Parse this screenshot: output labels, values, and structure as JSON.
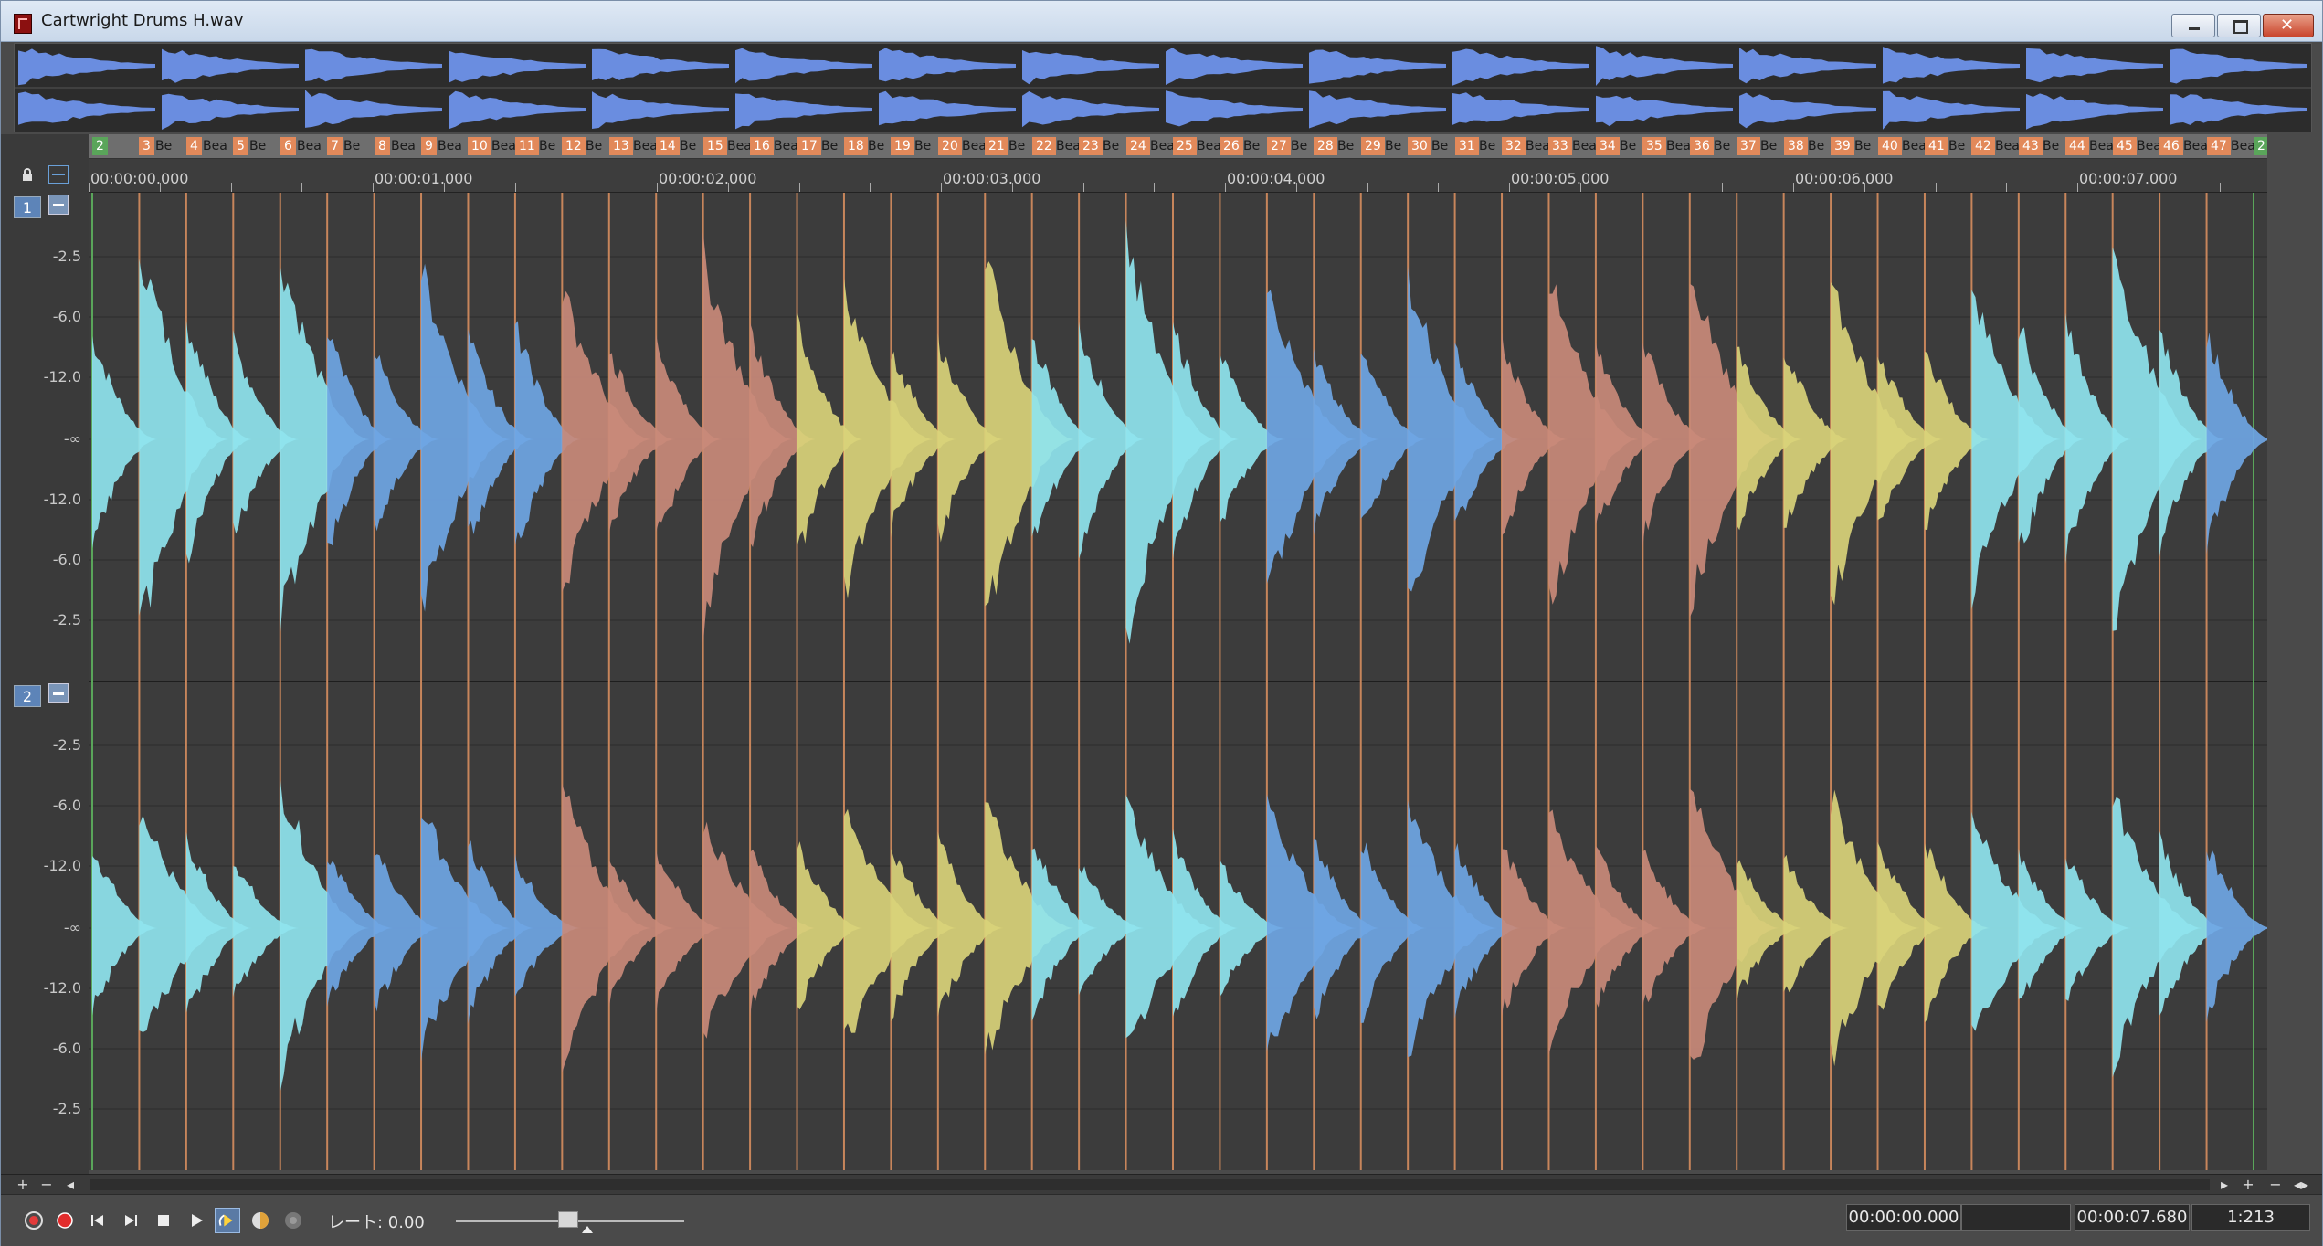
{
  "window": {
    "title": "Cartwright Drums H.wav"
  },
  "markers": {
    "items": [
      {
        "label": "2",
        "green": true,
        "beat": ""
      },
      {
        "label": "3",
        "beat": "Be"
      },
      {
        "label": "4",
        "beat": "Bea"
      },
      {
        "label": "5",
        "beat": "Be"
      },
      {
        "label": "6",
        "beat": "Bea"
      },
      {
        "label": "7",
        "beat": "Be"
      },
      {
        "label": "8",
        "beat": "Bea"
      },
      {
        "label": "9",
        "beat": "Bea"
      },
      {
        "label": "10",
        "beat": "Bea"
      },
      {
        "label": "11",
        "beat": "Be"
      },
      {
        "label": "12",
        "beat": "Be"
      },
      {
        "label": "13",
        "beat": "Bea"
      },
      {
        "label": "14",
        "beat": "Be"
      },
      {
        "label": "15",
        "beat": "Bea"
      },
      {
        "label": "16",
        "beat": "Bea"
      },
      {
        "label": "17",
        "beat": "Be"
      },
      {
        "label": "18",
        "beat": "Be"
      },
      {
        "label": "19",
        "beat": "Be"
      },
      {
        "label": "20",
        "beat": "Bea"
      },
      {
        "label": "21",
        "beat": "Be"
      },
      {
        "label": "22",
        "beat": "Bea"
      },
      {
        "label": "23",
        "beat": "Be"
      },
      {
        "label": "24",
        "beat": "Bea"
      },
      {
        "label": "25",
        "beat": "Bea"
      },
      {
        "label": "26",
        "beat": "Be"
      },
      {
        "label": "27",
        "beat": "Be"
      },
      {
        "label": "28",
        "beat": "Be"
      },
      {
        "label": "29",
        "beat": "Be"
      },
      {
        "label": "30",
        "beat": "Be"
      },
      {
        "label": "31",
        "beat": "Be"
      },
      {
        "label": "32",
        "beat": "Bea"
      },
      {
        "label": "33",
        "beat": "Bea"
      },
      {
        "label": "34",
        "beat": "Be"
      },
      {
        "label": "35",
        "beat": "Bea"
      },
      {
        "label": "36",
        "beat": "Be"
      },
      {
        "label": "37",
        "beat": "Be"
      },
      {
        "label": "38",
        "beat": "Be"
      },
      {
        "label": "39",
        "beat": "Be"
      },
      {
        "label": "40",
        "beat": "Bea"
      },
      {
        "label": "41",
        "beat": "Be"
      },
      {
        "label": "42",
        "beat": "Bea"
      },
      {
        "label": "43",
        "beat": "Be"
      },
      {
        "label": "44",
        "beat": "Beat"
      },
      {
        "label": "45",
        "beat": "Bea"
      },
      {
        "label": "46",
        "beat": "Bea"
      },
      {
        "label": "47",
        "beat": "Beat"
      },
      {
        "label": "2",
        "green": true,
        "beat": ""
      }
    ]
  },
  "timeline": {
    "labels": [
      "00:00:00.000",
      "00:00:01.000",
      "00:00:02.000",
      "00:00:03.000",
      "00:00:04.000",
      "00:00:05.000",
      "00:00:06.000",
      "00:00:07.000"
    ]
  },
  "channels": {
    "ch1": {
      "badge": "1"
    },
    "ch2": {
      "badge": "2"
    },
    "db_labels": [
      "-2.5",
      "-6.0",
      "-12.0",
      "-∞",
      "-12.0",
      "-6.0",
      "-2.5"
    ]
  },
  "transport": {
    "rate_label": "レート: 0.00",
    "rate_value": 0.43,
    "selection_start": "00:00:00.000",
    "selection_length": "",
    "end_time": "00:00:07.680",
    "zoom": "1:213"
  },
  "colors": {
    "accent": "#5d84b8",
    "marker": "#e2895a",
    "marker_green": "#5aa55a",
    "wave_cyan": "#8fe4ee",
    "wave_yellow": "#d9d27a",
    "wave_red": "#c98a7a",
    "wave_blue": "#6fa6e4",
    "overview_wave": "#6a8de0"
  }
}
